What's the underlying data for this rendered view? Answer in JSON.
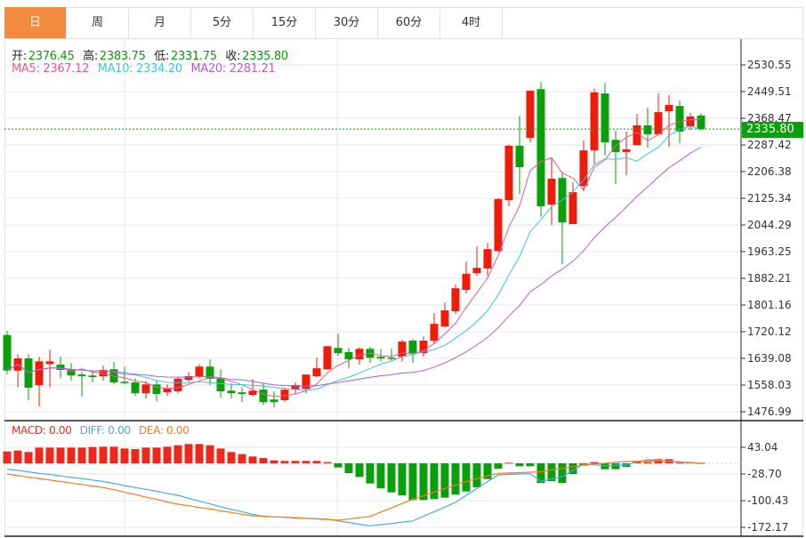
{
  "tabs": [
    {
      "label": "日",
      "active": true
    },
    {
      "label": "周"
    },
    {
      "label": "月"
    },
    {
      "label": "5分"
    },
    {
      "label": "15分"
    },
    {
      "label": "30分"
    },
    {
      "label": "60分"
    },
    {
      "label": "4时"
    }
  ],
  "ohlc_legend": {
    "open_label": "开:",
    "open": "2376.45",
    "high_label": "高:",
    "high": "2383.75",
    "low_label": "低:",
    "low": "2331.75",
    "close_label": "收:",
    "close": "2335.80"
  },
  "ma_legend": {
    "ma5": "MA5: 2367.12",
    "ma10": "MA10: 2334.20",
    "ma20": "MA20: 2281.21"
  },
  "macd_legend": {
    "macd": "MACD: 0.00",
    "diff": "DIFF: 0.00",
    "dea": "DEA: 0.00"
  },
  "current_price": "2335.80",
  "colors": {
    "up": "#f01c0a",
    "down": "#0aa00a",
    "ma5": "#ea5a8e",
    "ma10": "#3cc8e0",
    "ma20": "#b45fd0",
    "macd": "#f0281c",
    "diff": "#4aa8f0",
    "dea": "#f57c1f",
    "active_tab": "#f28b3f",
    "grid": "#e3e8ee"
  },
  "chart_data": [
    {
      "type": "candlestick",
      "fields": [
        "open",
        "high",
        "low",
        "close"
      ],
      "candles": [
        [
          1710,
          1723,
          1591,
          1602
        ],
        [
          1602,
          1652,
          1552,
          1639
        ],
        [
          1639,
          1652,
          1512,
          1550
        ],
        [
          1558,
          1644,
          1493,
          1630
        ],
        [
          1622,
          1666,
          1552,
          1630
        ],
        [
          1620,
          1644,
          1579,
          1604
        ],
        [
          1606,
          1625,
          1571,
          1587
        ],
        [
          1590,
          1598,
          1523,
          1585
        ],
        [
          1587,
          1603,
          1566,
          1582
        ],
        [
          1585,
          1617,
          1571,
          1604
        ],
        [
          1606,
          1628,
          1560,
          1566
        ],
        [
          1568,
          1614,
          1560,
          1566
        ],
        [
          1566,
          1579,
          1525,
          1533
        ],
        [
          1533,
          1571,
          1517,
          1560
        ],
        [
          1560,
          1571,
          1509,
          1531
        ],
        [
          1536,
          1560,
          1525,
          1547
        ],
        [
          1539,
          1582,
          1533,
          1577
        ],
        [
          1574,
          1598,
          1568,
          1585
        ],
        [
          1585,
          1622,
          1579,
          1614
        ],
        [
          1614,
          1636,
          1558,
          1577
        ],
        [
          1577,
          1606,
          1520,
          1539
        ],
        [
          1541,
          1563,
          1517,
          1533
        ],
        [
          1536,
          1552,
          1506,
          1531
        ],
        [
          1528,
          1576,
          1523,
          1541
        ],
        [
          1544,
          1563,
          1498,
          1506
        ],
        [
          1514,
          1539,
          1490,
          1506
        ],
        [
          1512,
          1550,
          1506,
          1544
        ],
        [
          1544,
          1566,
          1531,
          1558
        ],
        [
          1547,
          1590,
          1533,
          1590
        ],
        [
          1585,
          1641,
          1582,
          1609
        ],
        [
          1606,
          1677,
          1604,
          1676
        ],
        [
          1671,
          1714,
          1647,
          1655
        ],
        [
          1658,
          1671,
          1609,
          1636
        ],
        [
          1636,
          1674,
          1620,
          1668
        ],
        [
          1668,
          1674,
          1625,
          1641
        ],
        [
          1644,
          1668,
          1630,
          1639
        ],
        [
          1641,
          1668,
          1633,
          1639
        ],
        [
          1644,
          1696,
          1630,
          1690
        ],
        [
          1693,
          1698,
          1625,
          1655
        ],
        [
          1655,
          1706,
          1644,
          1693
        ],
        [
          1693,
          1777,
          1682,
          1744
        ],
        [
          1736,
          1809,
          1733,
          1785
        ],
        [
          1782,
          1863,
          1774,
          1852
        ],
        [
          1847,
          1933,
          1836,
          1896
        ],
        [
          1898,
          1979,
          1890,
          1914
        ],
        [
          1912,
          1990,
          1890,
          1971
        ],
        [
          1965,
          2126,
          1963,
          2123
        ],
        [
          2120,
          2288,
          2101,
          2285
        ],
        [
          2285,
          2376,
          2139,
          2220
        ],
        [
          2309,
          2454,
          2295,
          2452
        ],
        [
          2457,
          2479,
          2069,
          2101
        ],
        [
          2106,
          2250,
          2044,
          2185
        ],
        [
          2187,
          2206,
          1925,
          2052
        ],
        [
          2047,
          2174,
          2047,
          2144
        ],
        [
          2163,
          2301,
          2147,
          2271
        ],
        [
          2271,
          2458,
          2228,
          2447
        ],
        [
          2444,
          2476,
          2255,
          2295
        ],
        [
          2303,
          2331,
          2169,
          2266
        ],
        [
          2266,
          2328,
          2196,
          2274
        ],
        [
          2287,
          2382,
          2287,
          2347
        ],
        [
          2347,
          2401,
          2279,
          2320
        ],
        [
          2320,
          2444,
          2320,
          2387
        ],
        [
          2390,
          2439,
          2282,
          2409
        ],
        [
          2406,
          2422,
          2293,
          2328
        ],
        [
          2344,
          2385,
          2333,
          2374
        ],
        [
          2376.45,
          2383.75,
          2331.75,
          2335.8
        ]
      ],
      "overlays": [
        "MA5",
        "MA10",
        "MA20"
      ],
      "y_ticks": [
        "2530.55",
        "2449.51",
        "2368.47",
        "2287.42",
        "2206.38",
        "2125.34",
        "2044.29",
        "1963.25",
        "1882.21",
        "1801.16",
        "1720.12",
        "1639.08",
        "1558.03",
        "1476.99"
      ],
      "ylim": [
        1476.99,
        2530.55
      ],
      "grid": true
    },
    {
      "type": "bar+line",
      "name": "MACD",
      "macd": [
        31.9,
        34.3,
        30.3,
        42.2,
        42.2,
        42.2,
        42.2,
        42.2,
        43.8,
        44.6,
        44.6,
        39.8,
        38.3,
        42.2,
        42.2,
        44.6,
        48.6,
        51.8,
        51.8,
        48.6,
        39.8,
        30.3,
        24.7,
        18.3,
        14.3,
        8.0,
        6.4,
        6.4,
        6.4,
        6.4,
        3.2,
        -11.2,
        -26.3,
        -36.7,
        -54.2,
        -67.0,
        -78.1,
        -86.1,
        -98.8,
        -98.8,
        -96.4,
        -92.5,
        -84.5,
        -75.7,
        -64.6,
        -42.3,
        -14.3,
        1.5,
        -8.0,
        -8.0,
        -52.6,
        -47.8,
        -52.6,
        -28.7,
        -6.4,
        3.2,
        -15.9,
        -15.9,
        -9.6,
        4.8,
        3.2,
        11.2,
        11.2,
        1.6,
        3.2,
        1.0
      ],
      "diff": [
        -16,
        -19,
        -23,
        -27,
        -30,
        -34,
        -38,
        -41,
        -45,
        -49,
        -54,
        -60,
        -65,
        -70,
        -75,
        -81,
        -86,
        -94,
        -102,
        -109,
        -117,
        -124,
        -130,
        -137,
        -143,
        -144,
        -145,
        -146,
        -148,
        -149,
        -150,
        -155,
        -159,
        -164,
        -168,
        -165,
        -162,
        -158,
        -155,
        -142,
        -130,
        -118,
        -105,
        -86,
        -68,
        -49,
        -31,
        -30,
        -29,
        -28,
        -49,
        -42,
        -36,
        -19,
        -2,
        -4,
        -7,
        -5,
        -4,
        3,
        9.6,
        8,
        6,
        4,
        2,
        0
      ],
      "dea": [
        -29,
        -33,
        -37,
        -41,
        -45,
        -49,
        -53,
        -57,
        -61,
        -65,
        -71,
        -78,
        -84,
        -91,
        -97,
        -104,
        -110,
        -114,
        -119,
        -123,
        -128,
        -132,
        -137,
        -141,
        -142,
        -144,
        -145,
        -147,
        -148,
        -150,
        -151,
        -153,
        -150,
        -146,
        -143,
        -131,
        -120,
        -108,
        -97,
        -87,
        -78,
        -68,
        -59,
        -49,
        -42,
        -34,
        -27,
        -26,
        -25,
        -24,
        -23,
        -18,
        -14,
        -9,
        -4,
        -2,
        0,
        3,
        4.8,
        5.5,
        6.3,
        7,
        5,
        3.5,
        2,
        0
      ],
      "y_ticks": [
        "43.04",
        "-28.70",
        "-100.43",
        "-172.17"
      ],
      "grid": true
    }
  ]
}
